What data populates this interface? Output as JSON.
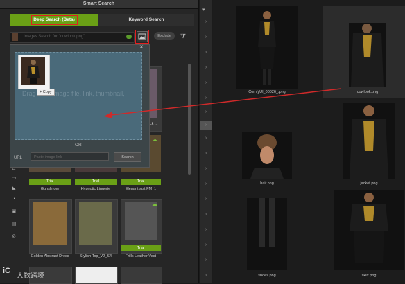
{
  "panel": {
    "title": "Smart Search",
    "tabs": [
      {
        "label": "Deep Search (Beta)"
      },
      {
        "label": "Keyword Search"
      }
    ],
    "search": {
      "placeholder": "Images Search for \"cowlook.png\""
    },
    "exclude_label": "Exclude"
  },
  "popup": {
    "drop_text": "Drag in an image file, link, thumbnail,",
    "copy_label": "+ Copy",
    "or_text": "OR",
    "url_label": "URL :",
    "url_placeholder": "Paste image link",
    "search_label": "Search"
  },
  "grid": {
    "trial_label": "Trial",
    "row1": [
      "Gunslinger",
      "Hypnotic Lingerie",
      "Elegant suit FM_1"
    ],
    "row2": [
      "Golden Abstract Dress",
      "Stylish Top_V2_S4",
      "Frills Leather Vest"
    ],
    "partial": [
      "",
      "",
      "black ..."
    ]
  },
  "gallery": {
    "items": [
      {
        "label": "ComfyUI_00026_.png"
      },
      {
        "label": "cowlook.png"
      },
      {
        "label": "hair.png"
      },
      {
        "label": "jacket.png"
      },
      {
        "label": "shoes.png"
      },
      {
        "label": "skirt.png"
      }
    ]
  },
  "watermark": "大数跨境"
}
